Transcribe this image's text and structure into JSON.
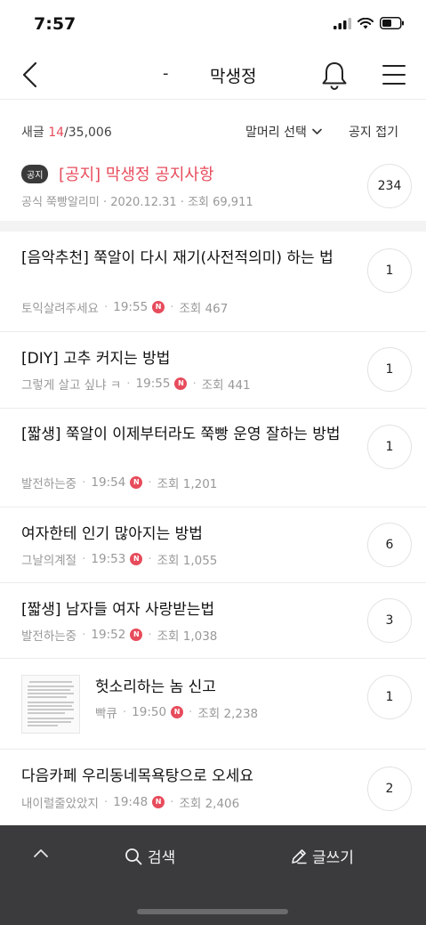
{
  "status": {
    "time": "7:57"
  },
  "nav": {
    "dash": "-",
    "title": "막생정"
  },
  "info": {
    "new_label": "새글 ",
    "new_count": "14",
    "total": "/35,006",
    "sort_label": "말머리 선택",
    "fold_label": "공지 접기"
  },
  "notice": {
    "badge": "공지",
    "title": "[공지] 막생정 공지사항",
    "meta": "공식 쭉빵알리미 · 2020.12.31 · 조회 69,911",
    "comments": "234"
  },
  "posts": [
    {
      "title": "[음악추천] 쭉알이 다시 재기(사전적의미) 하는 법",
      "author": "토익살려주세요",
      "time": "19:55",
      "new_badge": "N",
      "views": "조회 467",
      "comments": "1"
    },
    {
      "title": "[DIY] 고추 커지는 방법",
      "author": "그렇게 살고 싶냐 ㅋ",
      "time": "19:55",
      "new_badge": "N",
      "views": "조회 441",
      "comments": "1"
    },
    {
      "title": "[짧생] 쭉알이 이제부터라도 쭉빵 운영 잘하는 방법",
      "author": "발전하는중",
      "time": "19:54",
      "new_badge": "N",
      "views": "조회 1,201",
      "comments": "1"
    },
    {
      "title": "여자한테 인기 많아지는 방법",
      "author": "그날의계절",
      "time": "19:53",
      "new_badge": "N",
      "views": "조회 1,055",
      "comments": "6"
    },
    {
      "title": "[짧생] 남자들 여자 사랑받는법",
      "author": "발전하는중",
      "time": "19:52",
      "new_badge": "N",
      "views": "조회 1,038",
      "comments": "3"
    },
    {
      "title": "헛소리하는 놈 신고",
      "author": "빡큐",
      "time": "19:50",
      "new_badge": "N",
      "views": "조회 2,238",
      "comments": "1"
    },
    {
      "title": "다음카페 우리동네목욕탕으로 오세요",
      "author": "내이럴줄았았지",
      "time": "19:48",
      "new_badge": "N",
      "views": "조회 2,406",
      "comments": "2"
    }
  ],
  "bottom": {
    "search_label": "검색",
    "write_label": "글쓰기"
  },
  "colors": {
    "accent": "#e74c5c",
    "bottom_bar": "#3b3b3d"
  }
}
